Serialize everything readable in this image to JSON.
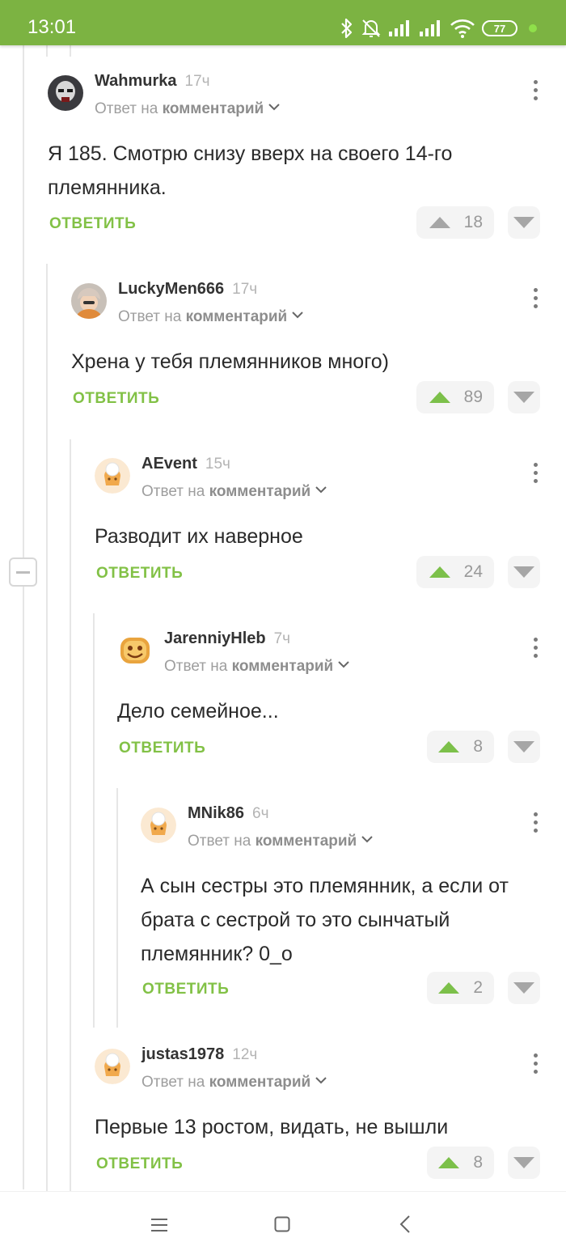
{
  "status_bar": {
    "time": "13:01",
    "battery": "77"
  },
  "labels": {
    "reply_prefix": "Ответ на",
    "reply_target": "комментарий",
    "reply_action": "ОТВЕТИТЬ"
  },
  "comments": [
    {
      "author": "Wahmurka",
      "age": "17ч",
      "text": "Я 185. Смотрю снизу вверх на своего 14-го племянника.",
      "rating": "18"
    },
    {
      "author": "LuckyMen666",
      "age": "17ч",
      "text": "Хрена у тебя племянников много)",
      "rating": "89"
    },
    {
      "author": "AEvent",
      "age": "15ч",
      "text": "Разводит их наверное",
      "rating": "24"
    },
    {
      "author": "JarenniyHleb",
      "age": "7ч",
      "text": "Дело семейное...",
      "rating": "8"
    },
    {
      "author": "MNik86",
      "age": "6ч",
      "text": "А сын сестры это племянник, а если от брата с сестрой то это сынчатый племянник? 0_о",
      "rating": "2"
    },
    {
      "author": "justas1978",
      "age": "12ч",
      "text": "Первые 13 ростом, видать, не вышли",
      "rating": "8"
    }
  ],
  "colors": {
    "accent": "#7cb342",
    "reply": "#82c146",
    "vote_up_active": "#7cc04a",
    "vote_neutral": "#a6a6a6"
  }
}
